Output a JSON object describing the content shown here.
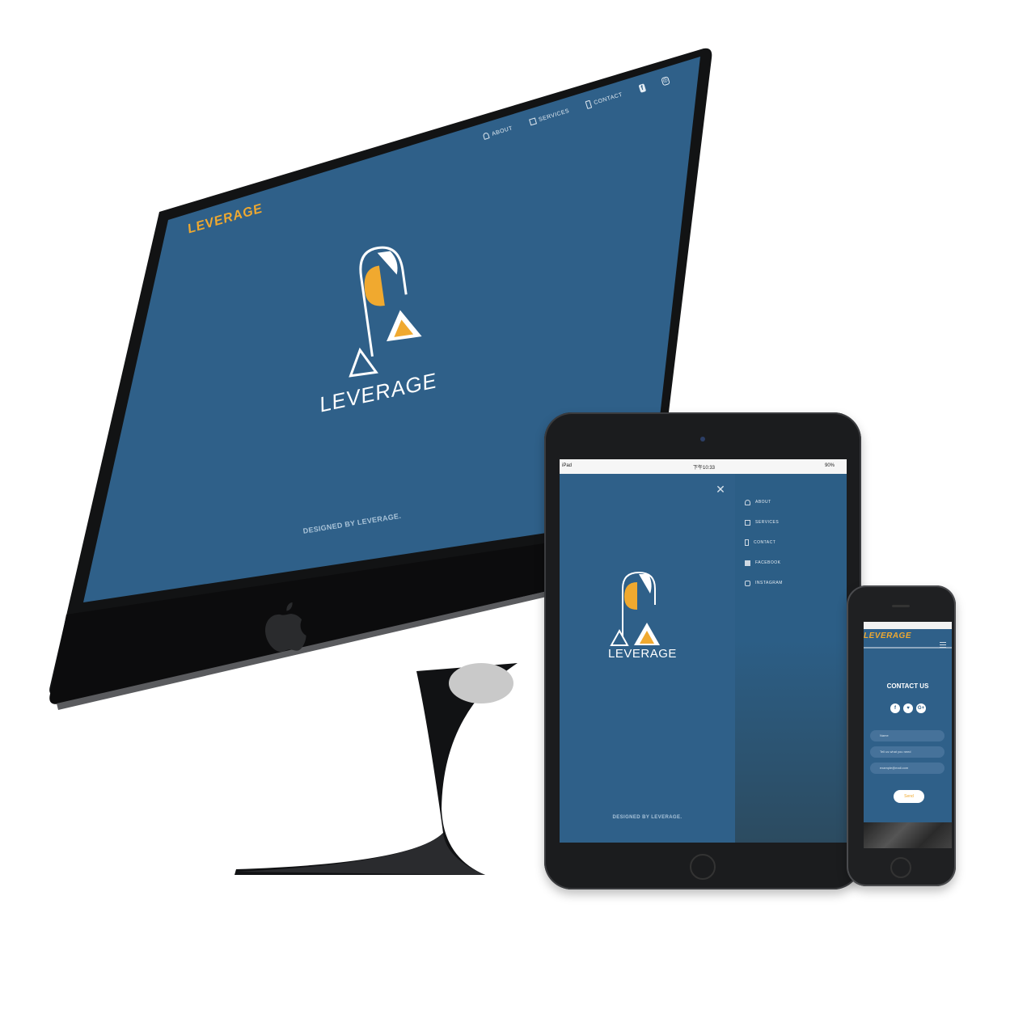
{
  "desktop": {
    "brand": "LEVERAGE",
    "nav": [
      {
        "label": "ABOUT",
        "icon": "person-icon"
      },
      {
        "label": "SERVICES",
        "icon": "cube-icon"
      },
      {
        "label": "CONTACT",
        "icon": "phone-icon"
      }
    ],
    "social": [
      {
        "icon": "facebook-icon",
        "glyph": "f"
      },
      {
        "icon": "instagram-icon",
        "glyph": "◎"
      }
    ],
    "logo_text": "LEVERAGE",
    "footer": "DESIGNED BY LEVERAGE."
  },
  "tablet": {
    "status": {
      "device": "iPad",
      "time": "下午10:33",
      "battery": "90%"
    },
    "close_glyph": "✕",
    "menu": [
      {
        "label": "ABOUT",
        "icon": "person-icon"
      },
      {
        "label": "SERVICES",
        "icon": "cube-icon"
      },
      {
        "label": "CONTACT",
        "icon": "phone-icon"
      },
      {
        "label": "FACEBOOK",
        "icon": "facebook-icon"
      },
      {
        "label": "INSTAGRAM",
        "icon": "instagram-icon"
      }
    ],
    "logo_text": "LEVERAGE",
    "footer": "DESIGNED BY LEVERAGE."
  },
  "phone": {
    "brand": "LEVERAGE",
    "contact_title": "CONTACT US",
    "social": [
      "f",
      "♥",
      "G+"
    ],
    "fields": [
      {
        "placeholder": "Name",
        "icon": "person-icon"
      },
      {
        "placeholder": "Tell us what you need",
        "icon": "message-icon"
      },
      {
        "placeholder": "example@mail.com",
        "icon": "mail-icon"
      }
    ],
    "send_label": "Send"
  },
  "colors": {
    "screen_blue": "#2f6089",
    "accent_orange": "#f0a92f",
    "device_black": "#1b1c1e"
  }
}
